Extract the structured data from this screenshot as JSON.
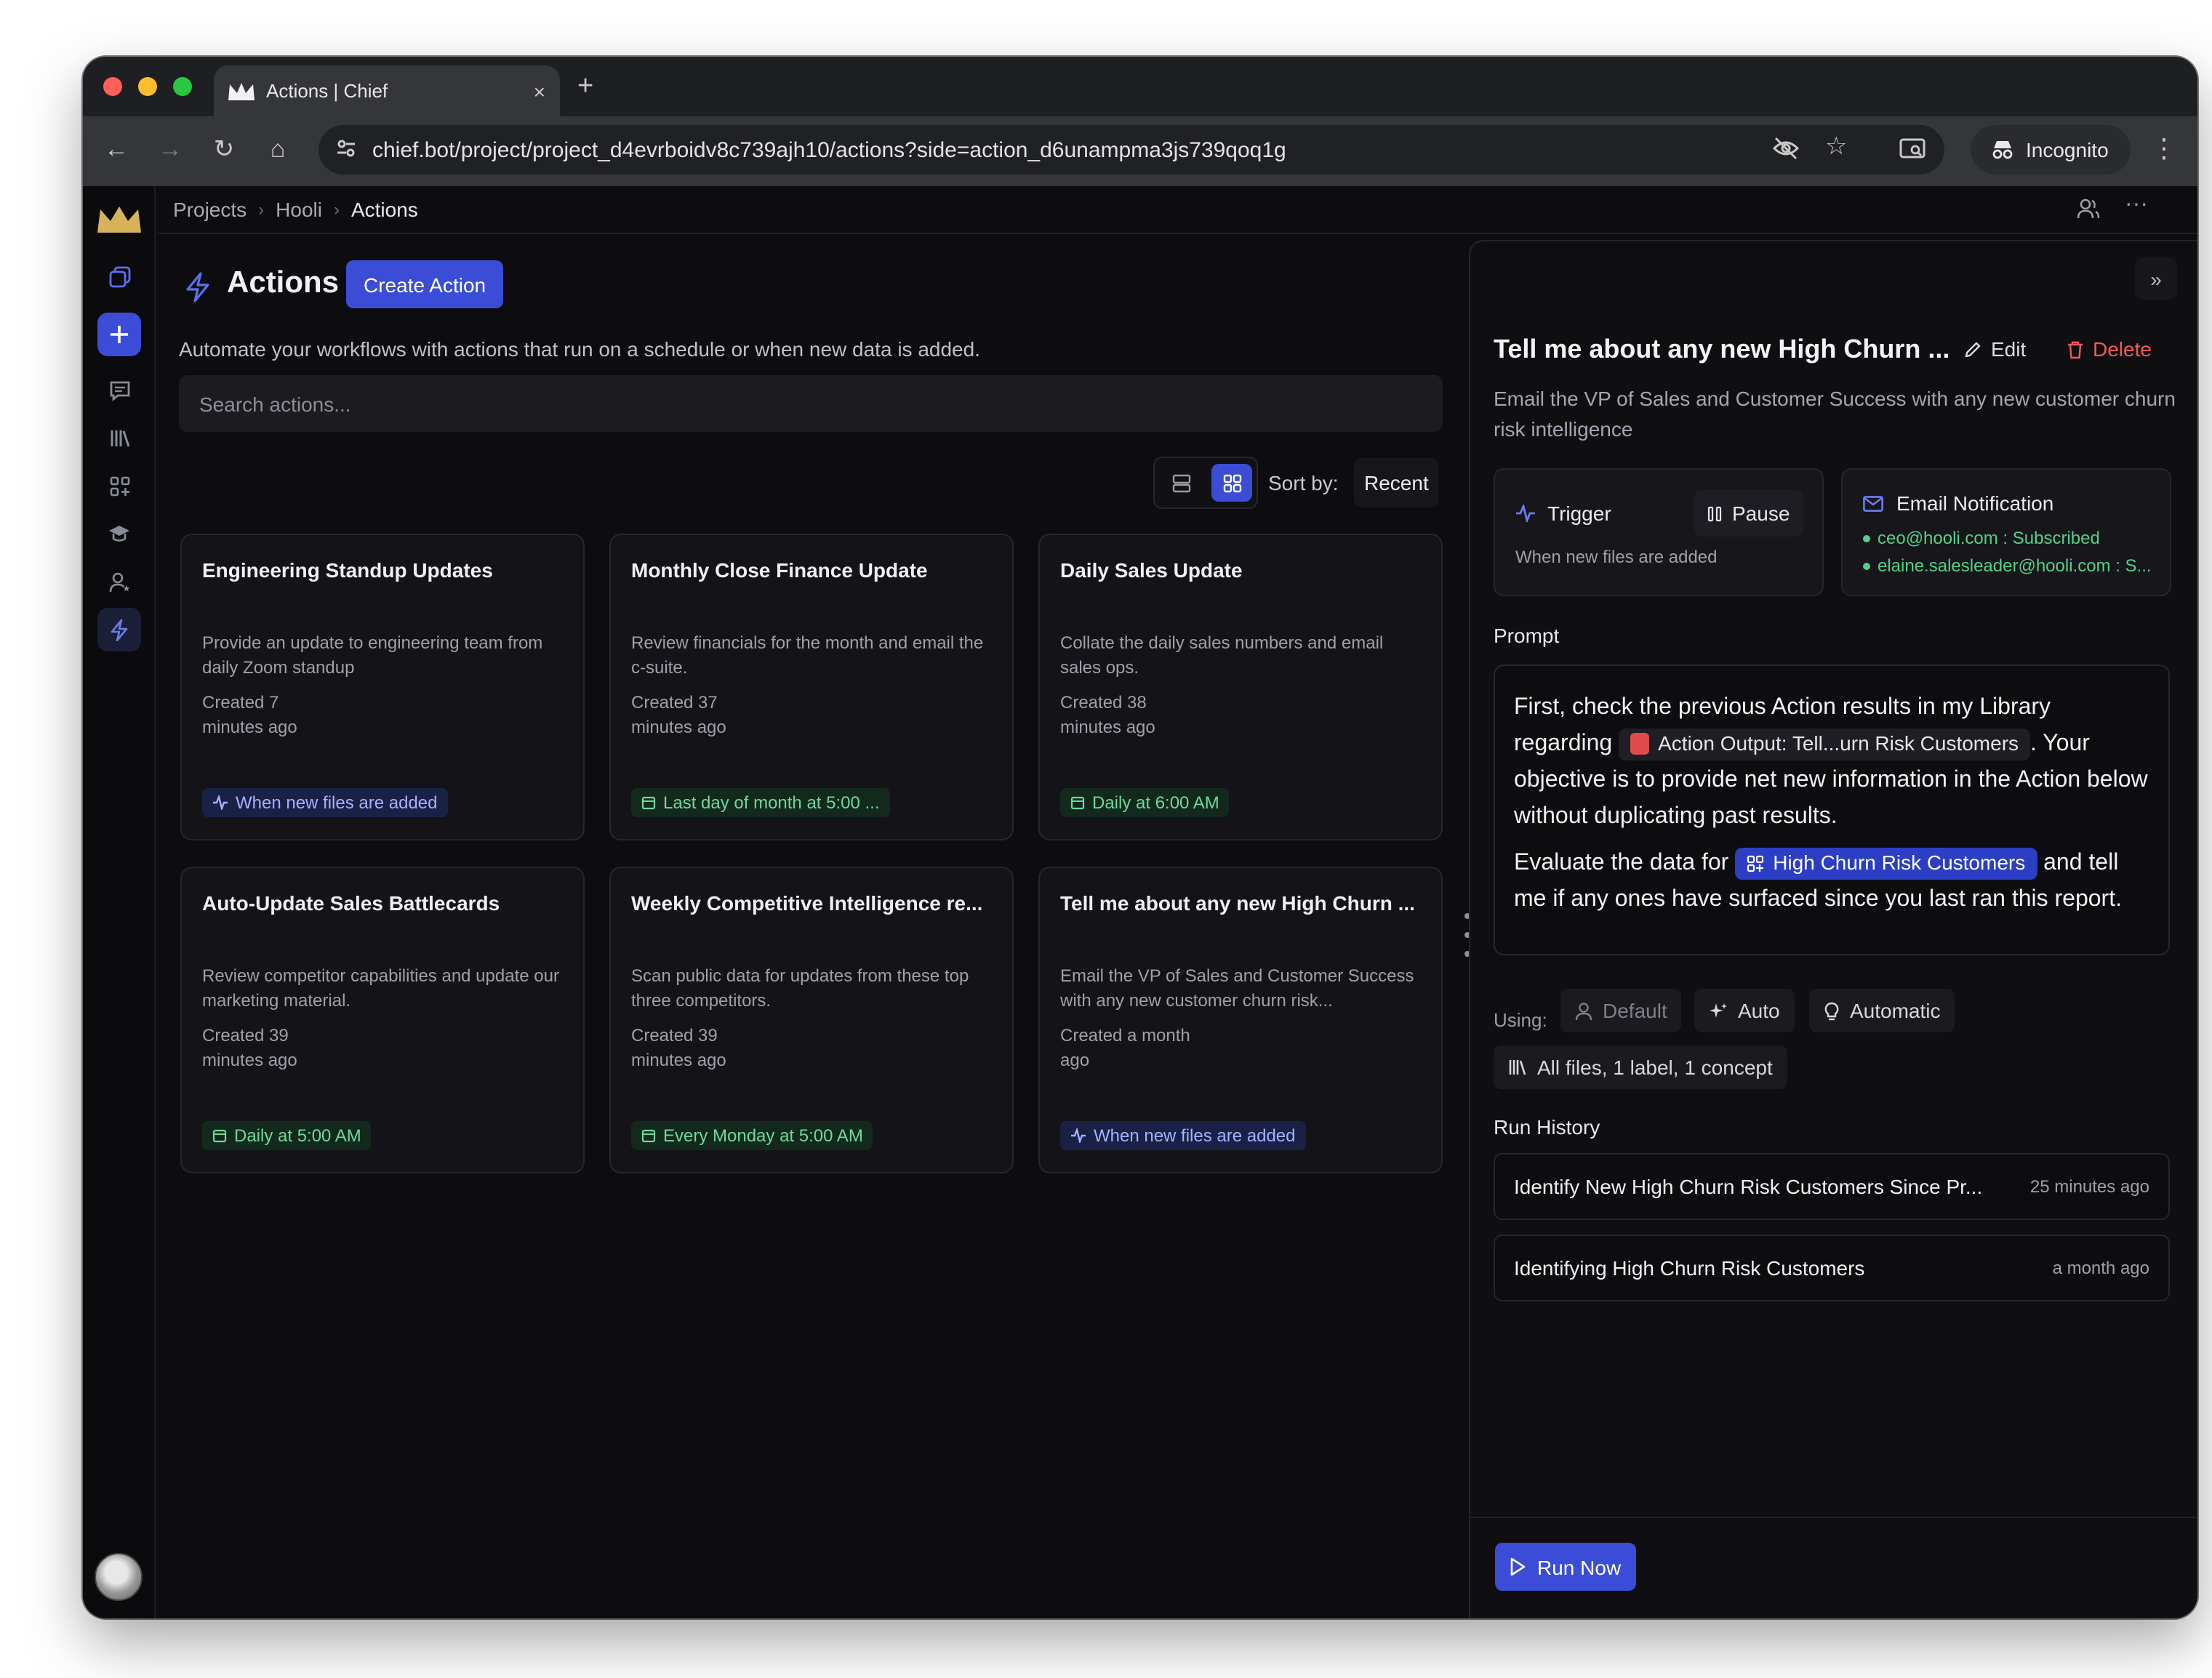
{
  "browser": {
    "tab_title": "Actions | Chief",
    "new_tab_symbol": "+",
    "close_tab_symbol": "×",
    "url": "chief.bot/project/project_d4evrboidv8c739ajh10/actions?side=action_d6unampma3js739qoq1g",
    "incognito_label": "Incognito"
  },
  "breadcrumb": [
    "Projects",
    "Hooli",
    "Actions"
  ],
  "main": {
    "title": "Actions",
    "create_button": "Create Action",
    "subtitle": "Automate your workflows with actions that run on a schedule or when new data is added.",
    "search_placeholder": "Search actions...",
    "sort_label": "Sort by:",
    "sort_value": "Recent",
    "view_mode": "grid"
  },
  "cards": [
    {
      "title": "Engineering Standup Updates",
      "description": "Provide an update to engineering team from daily Zoom standup",
      "created": "Created 7 minutes ago",
      "badge": "When new files are added",
      "badge_type": "trigger"
    },
    {
      "title": "Monthly Close Finance Update",
      "description": "Review financials for the month and email the c-suite.",
      "created": "Created 37 minutes ago",
      "badge": "Last day of month at 5:00 ...",
      "badge_type": "schedule"
    },
    {
      "title": "Daily Sales Update",
      "description": "Collate the daily sales numbers and email sales ops.",
      "created": "Created 38 minutes ago",
      "badge": "Daily at 6:00 AM",
      "badge_type": "schedule"
    },
    {
      "title": "Auto-Update Sales Battlecards",
      "description": "Review competitor capabilities and update our marketing material.",
      "created": "Created 39 minutes ago",
      "badge": "Daily at 5:00 AM",
      "badge_type": "schedule"
    },
    {
      "title": "Weekly Competitive Intelligence re...",
      "description": "Scan public data for updates from these top three competitors.",
      "created": "Created 39 minutes ago",
      "badge": "Every Monday at 5:00 AM",
      "badge_type": "schedule"
    },
    {
      "title": "Tell me about any new High Churn ...",
      "description": "Email the VP of Sales and Customer Success with any new customer churn risk...",
      "created": "Created a month ago",
      "badge": "When new files are added",
      "badge_type": "trigger"
    }
  ],
  "panel": {
    "title": "Tell me about any new High Churn ...",
    "edit_label": "Edit",
    "delete_label": "Delete",
    "description": "Email the VP of Sales and Customer Success with any new customer churn risk intelligence",
    "trigger": {
      "label": "Trigger",
      "pause_label": "Pause",
      "detail": "When new files are added"
    },
    "email": {
      "label": "Email Notification",
      "recipients": [
        "ceo@hooli.com : Subscribed",
        "elaine.salesleader@hooli.com : S..."
      ]
    },
    "prompt_label": "Prompt",
    "prompt": {
      "p1_before": "First, check the previous Action results in my Library regarding",
      "p1_chip": "Action Output: Tell...urn Risk Customers",
      "p1_after": ". Your objective is to provide net new information in the Action below without duplicating past results.",
      "p2_before": "Evaluate the data for",
      "p2_chip": "High Churn Risk Customers",
      "p2_after": "and tell me if any ones have surfaced since you last ran this report."
    },
    "using_label": "Using:",
    "using_options": [
      "Default",
      "Auto",
      "Automatic"
    ],
    "scope": "All files, 1 label, 1 concept",
    "run_history_label": "Run History",
    "run_history": [
      {
        "title": "Identify New High Churn Risk Customers Since Pr...",
        "time": "25 minutes ago"
      },
      {
        "title": "Identifying High Churn Risk Customers",
        "time": "a month ago"
      }
    ],
    "run_now_label": "Run Now"
  },
  "colors": {
    "accent": "#3b4dd6",
    "danger": "#ef5a5a",
    "success": "#55d089",
    "background": "#0d0d10"
  }
}
